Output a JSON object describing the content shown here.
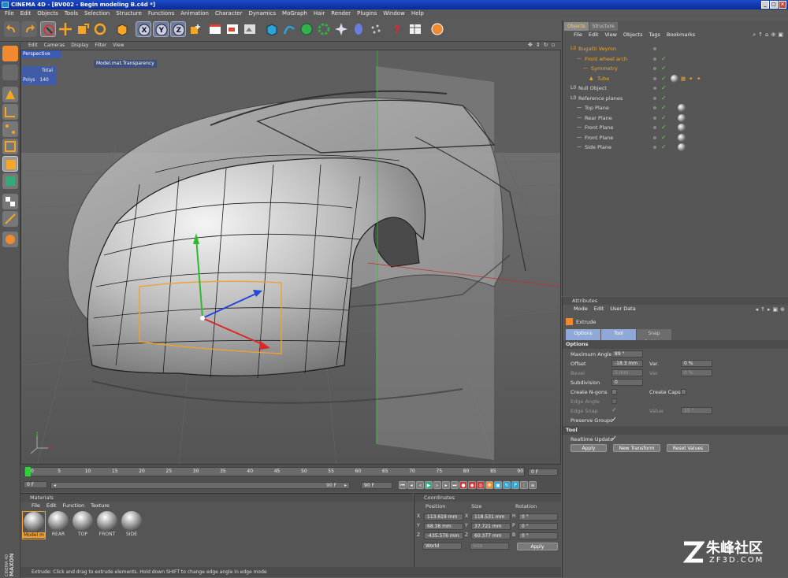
{
  "window": {
    "title": "CINEMA 4D - [BV002 - Begin modeling B.c4d *]"
  },
  "menu": [
    "File",
    "Edit",
    "Objects",
    "Tools",
    "Selection",
    "Structure",
    "Functions",
    "Animation",
    "Character",
    "Dynamics",
    "MoGraph",
    "Hair",
    "Render",
    "Plugins",
    "Window",
    "Help"
  ],
  "viewport": {
    "menu": [
      "Edit",
      "Cameras",
      "Display",
      "Filter",
      "View"
    ],
    "label": "Perspective",
    "hud_tooltip": "Model.mat.Transparency",
    "stats": {
      "total_label": "Total",
      "polys_label": "Polys",
      "polys_value": "140"
    }
  },
  "timeline": {
    "ticks": [
      "0",
      "5",
      "10",
      "15",
      "20",
      "25",
      "30",
      "35",
      "40",
      "45",
      "50",
      "55",
      "60",
      "65",
      "70",
      "75",
      "80",
      "85",
      "90"
    ],
    "current_frame": "0 F",
    "start": "0 F",
    "end_a": "90 F",
    "end_b": "90 F"
  },
  "materials": {
    "title": "Materials",
    "menu": [
      "File",
      "Edit",
      "Function",
      "Texture"
    ],
    "items": [
      "Model m",
      "REAR",
      "TOP",
      "FRONT",
      "SIDE"
    ]
  },
  "coordinates": {
    "title": "Coordinates",
    "headers": [
      "Position",
      "Size",
      "Rotation"
    ],
    "rows": [
      {
        "axis": "X",
        "pos": "113.619 mm",
        "saxis": "X",
        "size": "118.531 mm",
        "raxis": "H",
        "rot": "0 °"
      },
      {
        "axis": "Y",
        "pos": "68.38 mm",
        "saxis": "Y",
        "size": "37.721 mm",
        "raxis": "P",
        "rot": "0 °"
      },
      {
        "axis": "Z",
        "pos": "-435.576 mm",
        "saxis": "Z",
        "size": "60.377 mm",
        "raxis": "B",
        "rot": "0 °"
      }
    ],
    "mode_select": "World",
    "size_select": "Size",
    "apply_label": "Apply"
  },
  "status": "Extrude: Click and drag to extrude elements. Hold down SHIFT to change edge angle in edge mode",
  "objects_panel": {
    "tabs": [
      "Objects",
      "Structure"
    ],
    "menu": [
      "File",
      "Edit",
      "View",
      "Objects",
      "Tags",
      "Bookmarks"
    ],
    "tree": [
      {
        "name": "Bugatti Veyron",
        "indent": 0,
        "highlight": true
      },
      {
        "name": "Front wheel arch",
        "indent": 1,
        "highlight": true
      },
      {
        "name": "Symmetry",
        "indent": 2,
        "highlight": true
      },
      {
        "name": "Tube",
        "indent": 3,
        "highlight": true
      },
      {
        "name": "Null Object",
        "indent": 0,
        "highlight": false
      },
      {
        "name": "Reference planes",
        "indent": 0,
        "highlight": false
      },
      {
        "name": "Top Plane",
        "indent": 1,
        "highlight": false
      },
      {
        "name": "Rear Plane",
        "indent": 1,
        "highlight": false
      },
      {
        "name": "Front Plane",
        "indent": 1,
        "highlight": false
      },
      {
        "name": "Front Plane",
        "indent": 1,
        "highlight": false
      },
      {
        "name": "Side Plane",
        "indent": 1,
        "highlight": false
      }
    ]
  },
  "attributes": {
    "title": "Attributes",
    "menu": [
      "Mode",
      "Edit",
      "User Data"
    ],
    "tool_name": "Extrude",
    "tabs": [
      "Options",
      "Tool",
      "Snap Settings"
    ],
    "section_options": "Options",
    "max_angle_label": "Maximum Angle",
    "max_angle": "89 °",
    "offset_label": "Offset",
    "offset": "-18.3 mm",
    "var_label": "Var.",
    "var_value": "0 %",
    "bevel_label": "Bevel",
    "bevel": "5 mm",
    "bevel_var_value": "0 %",
    "subdiv_label": "Subdivision",
    "subdiv": "0",
    "ngons_label": "Create N-gons",
    "caps_label": "Create Caps",
    "edge_angle_label": "Edge Angle",
    "edge_snap_label": "Edge Snap",
    "value_label": "Value",
    "value": "15 °",
    "preserve_label": "Preserve Groups",
    "section_tool": "Tool",
    "realtime_label": "Realtime Update",
    "apply_label": "Apply",
    "new_transform_label": "New Transform",
    "reset_label": "Reset Values"
  },
  "watermark": {
    "chinese": "朱峰社区",
    "site": "ZF3D.COM"
  },
  "logo": {
    "side": "MAXON CINEMA 4D"
  }
}
